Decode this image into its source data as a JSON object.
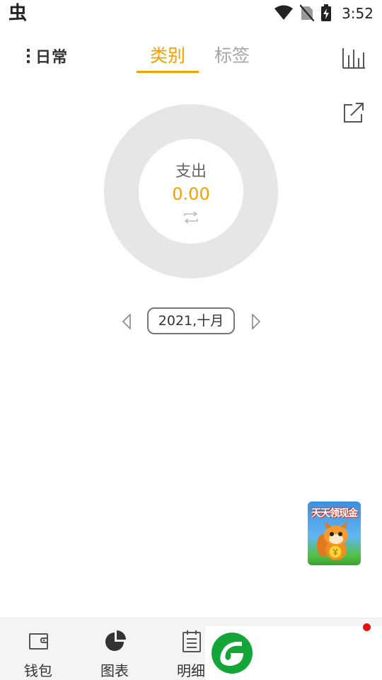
{
  "status_bar": {
    "app_icon_glyph": "虫",
    "time": "3:52"
  },
  "header": {
    "book_name": "日常",
    "tabs": [
      {
        "label": "类别",
        "active": true
      },
      {
        "label": "标签",
        "active": false
      }
    ],
    "chart_icon": "bar-chart-icon",
    "share_icon": "share-icon"
  },
  "summary": {
    "label": "支出",
    "amount": "0.00",
    "switch_icon": "switch-icon"
  },
  "date_nav": {
    "period": "2021,十月"
  },
  "ad": {
    "title": "天天领现金"
  },
  "bottom_nav": {
    "items": [
      {
        "label": "钱包",
        "icon": "wallet-icon"
      },
      {
        "label": "图表",
        "icon": "pie-chart-icon"
      },
      {
        "label": "明细",
        "icon": "list-icon"
      }
    ]
  },
  "colors": {
    "accent": "#f5a000",
    "inactive_tab": "#a5a5a5",
    "donut_empty": "#e6e6e6",
    "nav_background": "#f4f4f4"
  }
}
